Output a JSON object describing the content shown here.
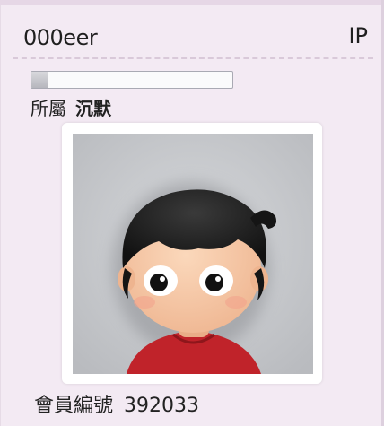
{
  "profile": {
    "username": "000eer",
    "ip_label": "IP",
    "level_progress_percent": 8,
    "affiliation_label": "所屬",
    "affiliation_value": "沉默",
    "member_id_label": "會員編號",
    "member_id": "392033"
  },
  "colors": {
    "background": "#f3eaf3",
    "avatar_bg": "#c8cacd",
    "shirt": "#c0232a",
    "hair": "#1c1c1c",
    "skin": "#f6c8a4"
  },
  "icons": {
    "avatar": "cartoon-boy-avatar"
  }
}
